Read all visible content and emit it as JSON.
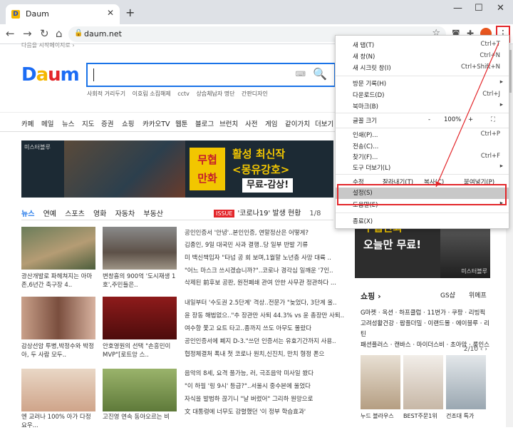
{
  "browser": {
    "tab_title": "Daum",
    "favicon_letter": "D",
    "close": "✕",
    "new_tab": "+",
    "min": "—",
    "max": "☐",
    "close_window": "✕",
    "url": "daum.net",
    "menu_dots": "⋮"
  },
  "page": {
    "start_link": "다음을 시작페이지로 ›",
    "logo": [
      "D",
      "a",
      "u",
      "m"
    ],
    "hotwords": [
      "사회적 거리두기",
      "이호림 소집해제",
      "cctv",
      "상습체납자 명단",
      "간판디자인"
    ],
    "gnb": [
      "카페",
      "메일",
      "뉴스",
      "지도",
      "증권",
      "쇼핑",
      "카카오TV",
      "웹툰",
      "블로그",
      "브런치",
      "사전",
      "게임",
      "같이가치",
      "더보기"
    ],
    "banner": {
      "tag": "미스터블루",
      "hero": "무협\n만화",
      "line1": "활성 최신작",
      "line2": "<몽유강호>",
      "line3": "무료-감상!"
    },
    "news_tabs": [
      "뉴스",
      "연예",
      "스포츠",
      "영화",
      "자동차",
      "부동산"
    ],
    "issue": {
      "badge": "ISSUE",
      "text": "'코로나19' 발생 현황",
      "page": "1/8"
    },
    "photo_news": [
      "광산개발로 파헤쳐지는 아마존,6년간 축구장 4..",
      "변창흠의 900억 '도시재생 1호',주민들은..",
      "감상선암 투병,박정수와 박정아, 두 사람 모두..",
      "안호영원의 선택 \"손흥민이 MVP\"[로트앙 스..",
      "엔 교러나 100% 아가 다정 요우...",
      "고진영 연속 동아오르는 비"
    ],
    "headlines_a": [
      "공인인증서 '안녕'..본인인증, 연말정산은 어떻게?",
      "김종인, 9일 대국민 사과 결행..당 일부 반발 기류",
      "미 백신책임자 \"타넘 공 회 보며,1월말 노년층 사망 대륙 ..",
      "\"어느 마스크 쓰시겠습니까?\"..코로나 경각심 일깨운 '7인..",
      "삭제된 前후보 공판, 원전폐쇄 관여 안한 사무관 정관하다 ..."
    ],
    "headlines_b": [
      "내일부터 '수도권 2.5단계' 격상..전문가 \"늦었다, 3단계 올..",
      "윤 장동 해법없으..\"추 장관만 사퇴 44.3% vs 윤 총장만 사퇴..",
      "여수항 쫓고 요트 타고..종까지 쓰도 아무도 몰랐다",
      "공인인증서에 폐지 D-3.\"쓰던 인증서는 유효기간까지 사용..",
      "협정체결처 폭내 첫 코로나 원치,신진치, 만치 형정 폰으"
    ],
    "headlines_c": [
      "음악의 8세, 요격 풀가능, 러, 극조음악 미사일 쐈다",
      "\"이 하필 '링 9시' 등급?\"..서울시 중수본에 울었다",
      "자식을 발범하 끊기니 \"날 버렸어\" 그리하 원망으로",
      "文 대통령에 너무도 강렬했던 '이 정부 학습효과'"
    ],
    "right_ad": {
      "line1": "무협만화",
      "line2": "오늘만 무료!",
      "tag": "미스터블루"
    },
    "shopping": {
      "title": "쇼핑 ›",
      "partners": [
        "GS샵",
        "위메프"
      ],
      "line1": "G마켓 · 옥션 · 하프클럽 · 11번가 · 쿠팡 · 리빙픽",
      "line2": "고려성활건강 · 팝플더밀 · 이랜드몰 · 에이블루 · 리틴",
      "line3": "패션플러스 · 캔바스 · 마이더스비 · 초아맘 · 룸인스",
      "pager": "2/10 ‹ ›",
      "captions": [
        "누드 블라우스",
        "BEST주문1위",
        "건조대 특가"
      ]
    }
  },
  "menu": {
    "new_tab": "새 탭(T)",
    "new_tab_sc": "Ctrl+T",
    "new_window": "새 창(N)",
    "new_window_sc": "Ctrl+N",
    "incognito": "새 시크릿 창(I)",
    "incognito_sc": "Ctrl+Shift+N",
    "history": "방문 기록(H)",
    "downloads": "다운로드(D)",
    "downloads_sc": "Ctrl+J",
    "bookmarks": "북마크(B)",
    "zoom": "글꼴 크기",
    "zoom_minus": "-",
    "zoom_value": "100%",
    "zoom_plus": "+",
    "fullscreen": "⛶",
    "print": "인쇄(P)...",
    "print_sc": "Ctrl+P",
    "cast": "전송(C)...",
    "find": "찾기(F)...",
    "find_sc": "Ctrl+F",
    "more_tools": "도구 더보기(L)",
    "edit": "수정",
    "cut": "잘라내기(T)",
    "copy": "복사(C)",
    "paste": "붙여넣기(P)",
    "settings": "설정(S)",
    "help": "도움말(E)",
    "exit": "종료(X)"
  },
  "colors": {
    "highlight": "#e3262a",
    "accent": "#1a73e8"
  }
}
